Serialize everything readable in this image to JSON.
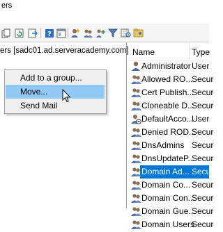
{
  "window": {
    "title": "ers"
  },
  "tree": {
    "root_label": "ers [sadc01.ad.serveracademy.com]"
  },
  "list": {
    "columns": {
      "name": "Name",
      "type": "Type"
    },
    "rows": [
      {
        "name": "Administrator",
        "type": "User",
        "icon": "user-icon"
      },
      {
        "name": "Allowed RO...",
        "type": "Secur",
        "icon": "group-icon"
      },
      {
        "name": "Cert Publish...",
        "type": "Secur",
        "icon": "group-icon"
      },
      {
        "name": "Cloneable D...",
        "type": "Secur",
        "icon": "group-icon"
      },
      {
        "name": "DefaultAcco...",
        "type": "User",
        "icon": "disabled-user-icon"
      },
      {
        "name": "Denied ROD...",
        "type": "Secur",
        "icon": "group-icon"
      },
      {
        "name": "DnsAdmins",
        "type": "Secur",
        "icon": "group-icon"
      },
      {
        "name": "DnsUpdateP...",
        "type": "Secur",
        "icon": "group-icon"
      },
      {
        "name": "Domain Ad...",
        "type": "Secur",
        "icon": "group-icon",
        "selected": true
      },
      {
        "name": "Domain Co...",
        "type": "Secur",
        "icon": "group-icon"
      },
      {
        "name": "Domain Con...",
        "type": "Secur",
        "icon": "group-icon"
      },
      {
        "name": "Domain Gue...",
        "type": "Secur",
        "icon": "group-icon"
      },
      {
        "name": "Domain Users",
        "type": "Secur",
        "icon": "group-icon"
      }
    ]
  },
  "context_menu": {
    "items": [
      {
        "label": "Add to a group..."
      },
      {
        "label": "Move...",
        "hover": true
      },
      {
        "label": "Send Mail"
      }
    ]
  },
  "colors": {
    "selection": "#0078d7",
    "menu_hover": "#91c9f7",
    "menu_bg": "#f0f0f0"
  }
}
